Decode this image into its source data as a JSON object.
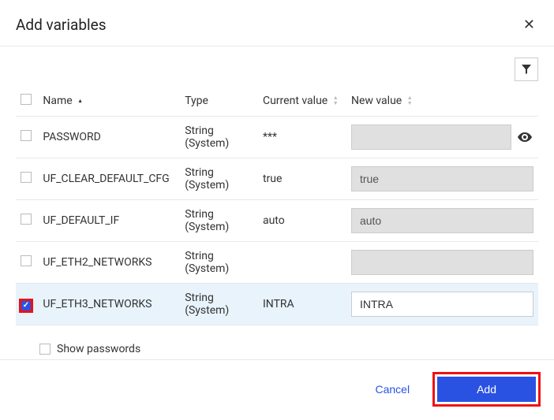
{
  "dialog": {
    "title": "Add variables"
  },
  "columns": {
    "name": "Name",
    "type": "Type",
    "current": "Current value",
    "newval": "New value"
  },
  "rows": [
    {
      "name": "PASSWORD",
      "type": "String (System)",
      "current": "***",
      "newval": "",
      "checked": false,
      "has_eye": true
    },
    {
      "name": "UF_CLEAR_DEFAULT_CFG",
      "type": "String (System)",
      "current": "true",
      "newval": "true",
      "checked": false,
      "has_eye": false
    },
    {
      "name": "UF_DEFAULT_IF",
      "type": "String (System)",
      "current": "auto",
      "newval": "auto",
      "checked": false,
      "has_eye": false
    },
    {
      "name": "UF_ETH2_NETWORKS",
      "type": "String (System)",
      "current": "",
      "newval": "",
      "checked": false,
      "has_eye": false
    },
    {
      "name": "UF_ETH3_NETWORKS",
      "type": "String (System)",
      "current": "INTRA",
      "newval": "INTRA",
      "checked": true,
      "has_eye": false
    }
  ],
  "footer": {
    "show_passwords": "Show passwords",
    "cancel": "Cancel",
    "add": "Add"
  }
}
